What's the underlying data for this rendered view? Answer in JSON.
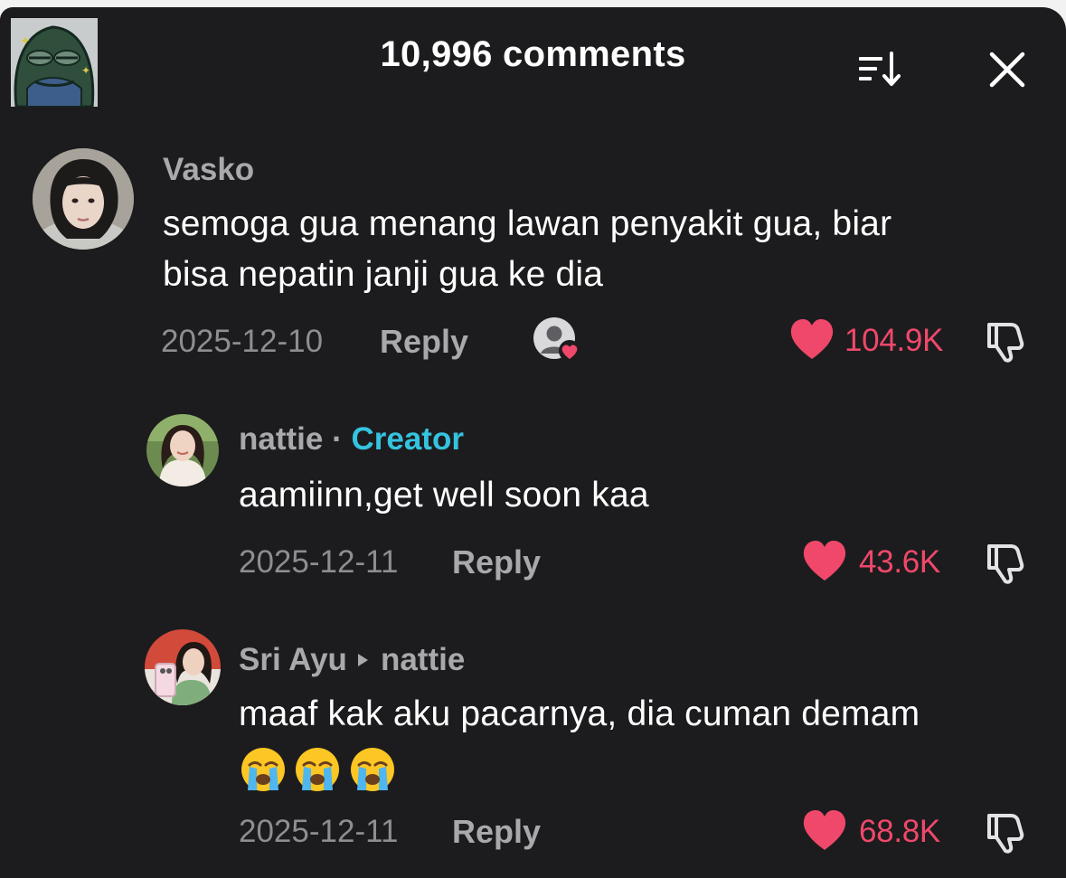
{
  "header": {
    "title": "10,996 comments",
    "sort_icon": "sort-icon",
    "close_icon": "close-icon"
  },
  "comments": [
    {
      "username": "Vasko",
      "text_lines": [
        "semoga gua menang lawan penyakit gua, biar",
        "bisa nepatin janji gua ke dia"
      ],
      "date": "2025-12-10",
      "reply_label": "Reply",
      "likes": "104.9K",
      "liked_by_creator": true
    },
    {
      "username": "nattie",
      "separator": "·",
      "creator_label": "Creator",
      "text_lines": [
        "aamiinn,get well soon kaa"
      ],
      "date": "2025-12-11",
      "reply_label": "Reply",
      "likes": "43.6K"
    },
    {
      "username": "Sri Ayu",
      "reply_to": "nattie",
      "text_lines": [
        "maaf kak aku pacarnya, dia cuman demam"
      ],
      "emojis": [
        "loudly-crying-face",
        "loudly-crying-face",
        "loudly-crying-face"
      ],
      "date": "2025-12-11",
      "reply_label": "Reply",
      "likes": "68.8K"
    }
  ],
  "colors": {
    "background": "#1c1c1e",
    "like_red": "#f0486a",
    "creator_cyan": "#35c3df",
    "text_primary": "#ffffff",
    "text_secondary": "#a9a9ad"
  }
}
